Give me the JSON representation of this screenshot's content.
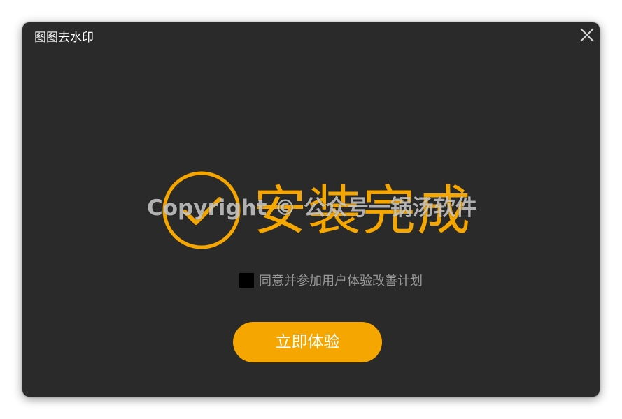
{
  "window": {
    "title": "图图去水印",
    "close_icon": "close-icon"
  },
  "main": {
    "headline": "安装完成",
    "check_icon": "check-circle-icon",
    "watermark": "Copyright © 公众号一锅汤软件",
    "agree_label": "同意并参加用户体验改善计划",
    "agree_checked": false,
    "start_button_label": "立即体验"
  },
  "colors": {
    "background": "#2b2a2b",
    "accent": "#f5a700",
    "button": "#f5a600",
    "muted_text": "#9a9a9a"
  }
}
